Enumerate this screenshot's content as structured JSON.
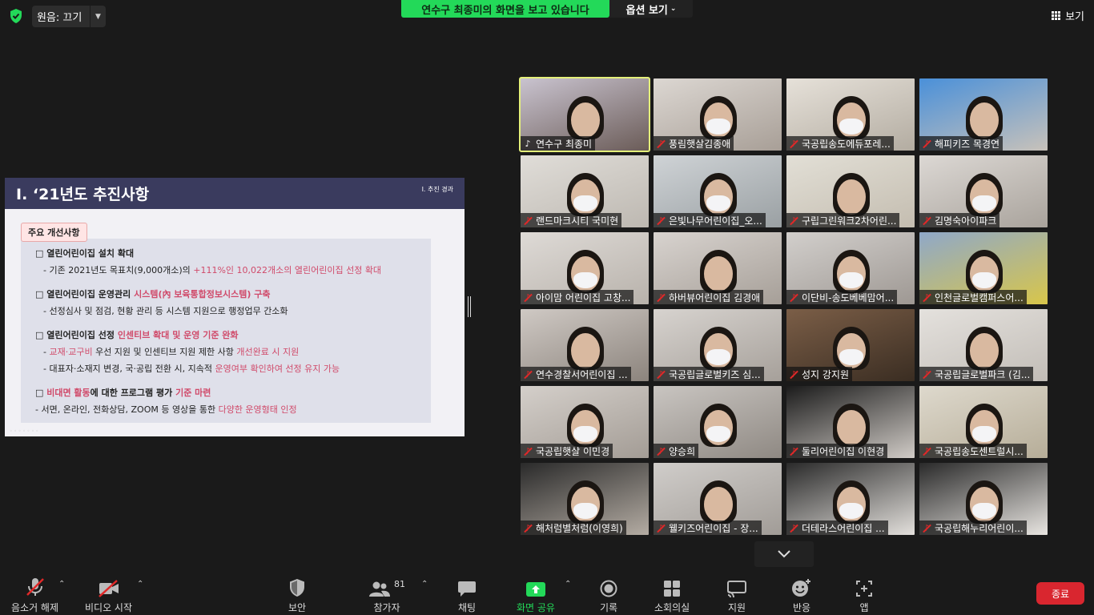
{
  "topbar": {
    "audio_label": "원음: 끄기",
    "share_banner": "연수구  최종미의 화면을 보고 있습니다",
    "view_options": "옵션 보기",
    "view_label": "보기"
  },
  "slide": {
    "title": "Ⅰ. ‘21년도 추진사항",
    "section_tag": "Ⅰ. 추진 경과",
    "pill": "주요 개선사항",
    "l1": "□ 열린어린이집 설치 확대",
    "l2a": "- 기존 2021년도 목표치(9,000개소)의 ",
    "l2b": "+111%인 10,022개소의 열린어린이집 선정 확대",
    "l3a": "□ 열린어린이집 운영관리 ",
    "l3b": "시스템(內 보육통합정보시스템) 구축",
    "l4": "- 선정심사 및 점검, 현황 관리 등 시스템 지원으로 행정업무 간소화",
    "l5a": "□ 열린어린이집 선정 ",
    "l5b": "인센티브 확대 및 운영 기준 완화",
    "l6a": "- ",
    "l6b": "교재·교구비",
    "l6c": " 우선 지원 및 인센티브 지원 제한 사항 ",
    "l6d": "개선완료 시 지원",
    "l7a": "- 대표자·소재지 변경, 국·공립 전환 시, 지속적 ",
    "l7b": "운영여부 확인하여 선정 유지 가능",
    "l8a": "□ ",
    "l8b": "비대면 활동",
    "l8c": "에 대한 프로그램 평가 ",
    "l8d": "기준 마련",
    "l9a": "- 서면, 온라인, 전화상담, ZOOM 등 영상을 통한 ",
    "l9b": "다양한 운영형태 인정"
  },
  "participants": [
    {
      "name": "연수구  최종미",
      "muted": false
    },
    {
      "name": "풍림햇살김종애",
      "muted": true
    },
    {
      "name": "국공립송도에듀포레...",
      "muted": true
    },
    {
      "name": "해피키즈 목경연",
      "muted": true
    },
    {
      "name": "랜드마크시티 국미현",
      "muted": true
    },
    {
      "name": "은빛나무어린이집_오...",
      "muted": true
    },
    {
      "name": "구립그린워크2차어린...",
      "muted": true
    },
    {
      "name": "김명숙아이파크",
      "muted": true
    },
    {
      "name": "아이맘 어린이집 고창...",
      "muted": true
    },
    {
      "name": "하버뷰어린이집 김경애",
      "muted": true
    },
    {
      "name": "이단비-송도베베맘어...",
      "muted": true
    },
    {
      "name": "인천글로벌캠퍼스어...",
      "muted": true
    },
    {
      "name": "연수경찰서어린이집 ...",
      "muted": true
    },
    {
      "name": "국공립글로벌키즈 심...",
      "muted": true
    },
    {
      "name": "성지  강지원",
      "muted": true
    },
    {
      "name": "국공립글로벌파크 (김...",
      "muted": true
    },
    {
      "name": "국공립햇살 이민경",
      "muted": true
    },
    {
      "name": "양승희",
      "muted": true
    },
    {
      "name": "둘리어린이집 이현경",
      "muted": true
    },
    {
      "name": "국공립송도센트럴시...",
      "muted": true
    },
    {
      "name": "해처럼별처럼(이영희)",
      "muted": true
    },
    {
      "name": "웰키즈어린이집 - 장...",
      "muted": true
    },
    {
      "name": "더테라스어린이집   ...",
      "muted": true
    },
    {
      "name": "국공립해누리어린이...",
      "muted": true
    }
  ],
  "toolbar": {
    "mute": "음소거 해제",
    "video": "비디오 시작",
    "security": "보안",
    "participants": "참가자",
    "participant_count": "81",
    "chat": "채팅",
    "share": "화면 공유",
    "record": "기록",
    "breakout": "소회의실",
    "support": "지원",
    "reactions": "반응",
    "apps": "앱",
    "end": "종료"
  },
  "colors": {
    "share_green": "#23d959",
    "end_red": "#d9262f",
    "active_speaker": "#e4f07a",
    "slide_header": "#3a3b5e",
    "slide_accent": "#d04a6a"
  }
}
